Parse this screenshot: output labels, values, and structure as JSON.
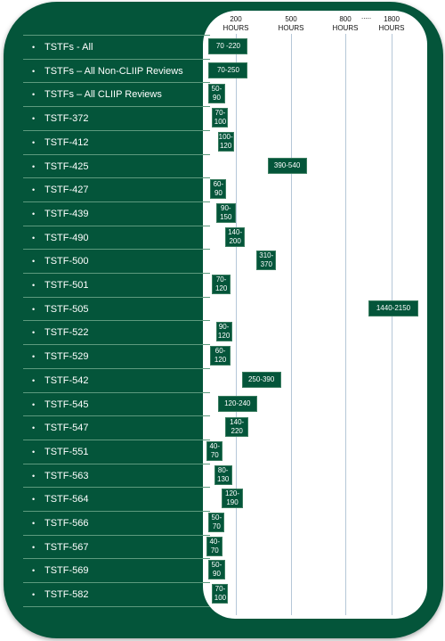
{
  "chart_data": {
    "type": "range-bar",
    "title": "",
    "xlabel": "Hours",
    "ticks": [
      {
        "value": 200,
        "label_top": "200",
        "label_bottom": "HOURS"
      },
      {
        "value": 500,
        "label_top": "500",
        "label_bottom": "HOURS"
      },
      {
        "value": 800,
        "label_top": "800",
        "label_bottom": "HOURS"
      },
      {
        "value": 1800,
        "label_top": "1800",
        "label_bottom": "HOURS"
      }
    ],
    "axis_break": {
      "after": 800,
      "label": "....."
    },
    "grid": true,
    "categories": [
      "TSTFs - All",
      "TSTFs – All Non-CLIIP Reviews",
      "TSTFs – All CLIIP Reviews",
      "TSTF-372",
      "TSTF-412",
      "TSTF-425",
      "TSTF-427",
      "TSTF-439",
      "TSTF-490",
      "TSTF-500",
      "TSTF-501",
      "TSTF-505",
      "TSTF-522",
      "TSTF-529",
      "TSTF-542",
      "TSTF-545",
      "TSTF-547",
      "TSTF-551",
      "TSTF-563",
      "TSTF-564",
      "TSTF-566",
      "TSTF-567",
      "TSTF-569",
      "TSTF-582"
    ],
    "ranges": [
      {
        "low": 70,
        "high": 220,
        "label": "70 -220",
        "wrap": false
      },
      {
        "low": 70,
        "high": 250,
        "label": "70-250",
        "wrap": false
      },
      {
        "low": 50,
        "high": 90,
        "label": "50-\n90",
        "wrap": true
      },
      {
        "low": 70,
        "high": 100,
        "label": "70-\n100",
        "wrap": true
      },
      {
        "low": 100,
        "high": 120,
        "label": "100-\n120",
        "wrap": true
      },
      {
        "low": 390,
        "high": 540,
        "label": "390-540",
        "wrap": false
      },
      {
        "low": 60,
        "high": 90,
        "label": "60-\n90",
        "wrap": true
      },
      {
        "low": 90,
        "high": 150,
        "label": "90-\n150",
        "wrap": true
      },
      {
        "low": 140,
        "high": 200,
        "label": "140-\n200",
        "wrap": true
      },
      {
        "low": 310,
        "high": 370,
        "label": "310-\n370",
        "wrap": true
      },
      {
        "low": 70,
        "high": 120,
        "label": "70-\n120",
        "wrap": true
      },
      {
        "low": 1440,
        "high": 2150,
        "label": "1440-2150",
        "wrap": false
      },
      {
        "low": 90,
        "high": 120,
        "label": "90-\n120",
        "wrap": true
      },
      {
        "low": 60,
        "high": 120,
        "label": "60-\n120",
        "wrap": true
      },
      {
        "low": 250,
        "high": 390,
        "label": "250-390",
        "wrap": false
      },
      {
        "low": 120,
        "high": 240,
        "label": "120-240",
        "wrap": false
      },
      {
        "low": 140,
        "high": 220,
        "label": "140-\n220",
        "wrap": true
      },
      {
        "low": 40,
        "high": 70,
        "label": "40-\n70",
        "wrap": true
      },
      {
        "low": 80,
        "high": 130,
        "label": "80-\n130",
        "wrap": true
      },
      {
        "low": 120,
        "high": 190,
        "label": "120-\n190",
        "wrap": true
      },
      {
        "low": 50,
        "high": 70,
        "label": "50-\n70",
        "wrap": true
      },
      {
        "low": 40,
        "high": 70,
        "label": "40-\n70",
        "wrap": true
      },
      {
        "low": 50,
        "high": 90,
        "label": "50-\n90",
        "wrap": true
      },
      {
        "low": 70,
        "high": 100,
        "label": "70-\n100",
        "wrap": true
      }
    ]
  },
  "colors": {
    "brand_green": "#04553a",
    "gridline": "#b5c7d8",
    "panel": "#ffffff"
  }
}
